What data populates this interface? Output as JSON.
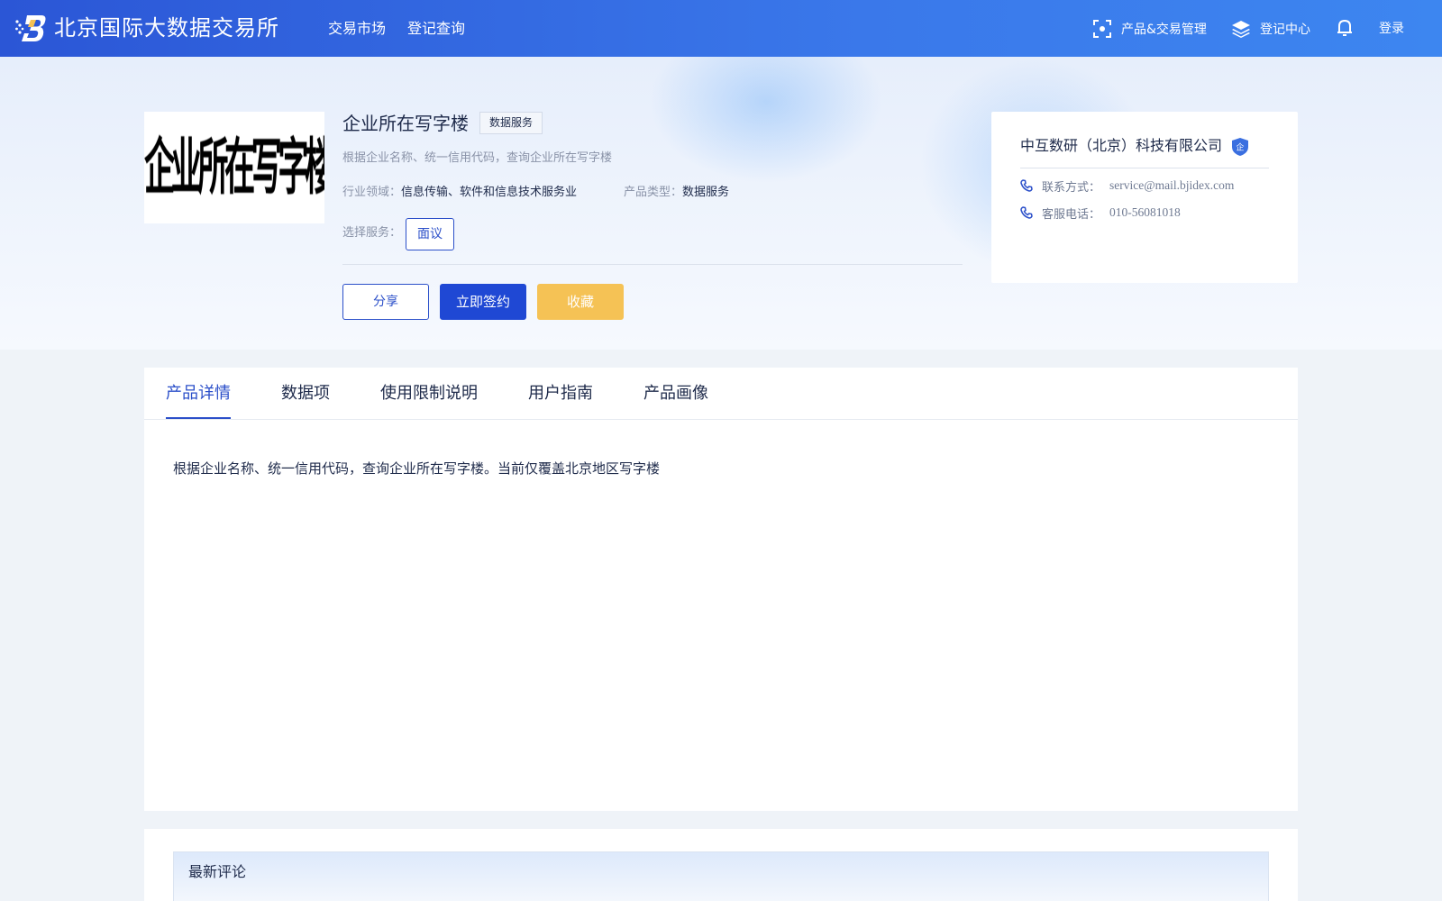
{
  "header": {
    "site_title": "北京国际大数据交易所",
    "nav": [
      "交易市场",
      "登记查询"
    ],
    "product_trade_manage": "产品&交易管理",
    "registration_center": "登记中心",
    "login": "登录",
    "icons": [
      "scan-icon",
      "layers-icon",
      "bell-icon"
    ]
  },
  "product": {
    "image_text": "企业所在写字楼",
    "title": "企业所在写字楼",
    "tag": "数据服务",
    "description": "根据企业名称、统一信用代码，查询企业所在写字楼",
    "industry_label": "行业领域：",
    "industry_value": "信息传输、软件和信息技术服务业",
    "type_label": "产品类型：",
    "type_value": "数据服务",
    "service_label": "选择服务：",
    "service_option": "面议",
    "buttons": {
      "share": "分享",
      "sign": "立即签约",
      "favorite": "收藏"
    }
  },
  "vendor": {
    "name": "中互数研（北京）科技有限公司",
    "badge": "企",
    "contact_label": "联系方式：",
    "contact_value": "service@mail.bjidex.com",
    "phone_label": "客服电话：",
    "phone_value": "010-56081018"
  },
  "tabs": {
    "items": [
      "产品详情",
      "数据项",
      "使用限制说明",
      "用户指南",
      "产品画像"
    ],
    "active": "产品详情"
  },
  "detail": {
    "text": "根据企业名称、统一信用代码，查询企业所在写字楼。当前仅覆盖北京地区写字楼"
  },
  "comments": {
    "title": "最新评论"
  },
  "colors": {
    "header_start": "#2b56d6",
    "header_end": "#3d86f0",
    "primary": "#2b4fc9",
    "sign_button": "#1f48d4",
    "favorite_button": "#f5c255"
  }
}
